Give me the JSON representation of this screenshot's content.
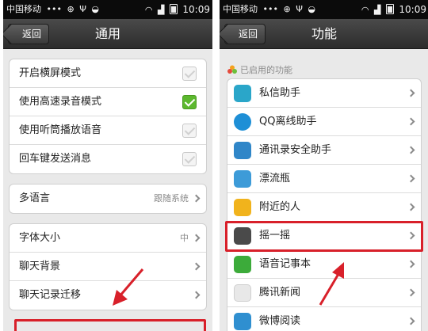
{
  "left": {
    "status": {
      "carrier": "中国移动",
      "dots": "•••",
      "time": "10:09"
    },
    "title": "通用",
    "back_label": "返回",
    "group1": [
      {
        "label": "开启横屏模式",
        "checked": false
      },
      {
        "label": "使用高速录音模式",
        "checked": true
      },
      {
        "label": "使用听筒播放语音",
        "checked": false
      },
      {
        "label": "回车键发送消息",
        "checked": false
      }
    ],
    "language": {
      "label": "多语言",
      "value": "跟随系统"
    },
    "group3": [
      {
        "label": "字体大小",
        "value": "中"
      },
      {
        "label": "聊天背景",
        "value": ""
      },
      {
        "label": "聊天记录迁移",
        "value": ""
      }
    ]
  },
  "right": {
    "status": {
      "carrier": "中国移动",
      "dots": "•••",
      "time": "10:09"
    },
    "title": "功能",
    "back_label": "返回",
    "section_label": "已启用的功能",
    "features": [
      {
        "label": "私信助手",
        "icon": "pin-icon",
        "color": "#2aa6c9"
      },
      {
        "label": "QQ离线助手",
        "icon": "chat-bubble-icon",
        "color": "#1e8fd6"
      },
      {
        "label": "通讯录安全助手",
        "icon": "contact-card-icon",
        "color": "#2f86c8"
      },
      {
        "label": "漂流瓶",
        "icon": "bottle-icon",
        "color": "#3d9bd8"
      },
      {
        "label": "附近的人",
        "icon": "location-pin-icon",
        "color": "#f1b31c"
      },
      {
        "label": "摇一摇",
        "icon": "phone-shake-icon",
        "color": "#4a4a4a"
      },
      {
        "label": "语音记事本",
        "icon": "voice-note-icon",
        "color": "#3cab3a"
      },
      {
        "label": "腾讯新闻",
        "icon": "news-globe-icon",
        "color": "#e8e8e8"
      },
      {
        "label": "微博阅读",
        "icon": "weibo-reader-icon",
        "color": "#2f8fd0"
      }
    ]
  },
  "colors": {
    "highlight": "#d8202a",
    "checkbox_on": "#5cb82e",
    "titlebar": "#333333"
  }
}
